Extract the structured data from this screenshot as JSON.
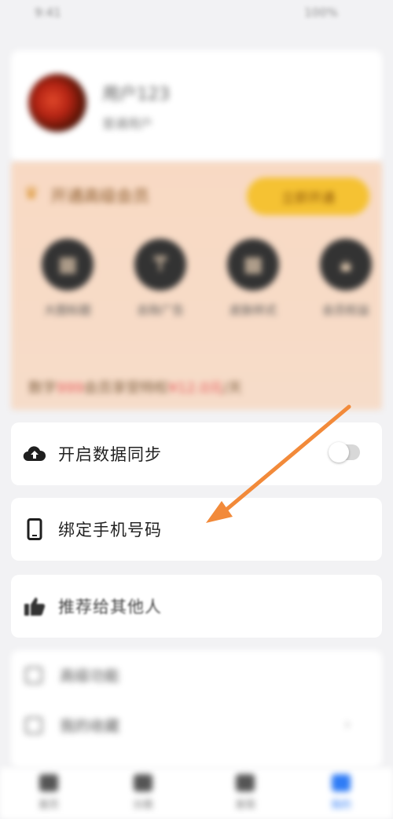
{
  "status_bar": {
    "left": "9:41",
    "right": "100%"
  },
  "profile": {
    "username": "用户123",
    "subtitle": "普通用户"
  },
  "vip": {
    "title": "开通高级会员",
    "button": "立即开通",
    "benefits": [
      {
        "label": "大图标题"
      },
      {
        "label": "去除广告"
      },
      {
        "label": "皮肤样式"
      },
      {
        "label": "会员权益"
      }
    ],
    "note_prefix": "数字",
    "note_highlight1": "999",
    "note_mid": "会员享受特权",
    "note_highlight2": "¥12.0元",
    "note_suffix": "/天"
  },
  "menu": {
    "sync_label": "开启数据同步",
    "bind_phone_label": "绑定手机号码",
    "recommend_label": "推荐给其他人",
    "more1_label": "高级功能",
    "more2_label": "我的收藏"
  },
  "tabbar": {
    "tabs": [
      {
        "label": "首页"
      },
      {
        "label": "分类"
      },
      {
        "label": "发现"
      },
      {
        "label": "我的"
      }
    ]
  },
  "colors": {
    "accent": "#2f7cf6",
    "arrow": "#f28a3a",
    "vip_button": "#f5c233"
  }
}
